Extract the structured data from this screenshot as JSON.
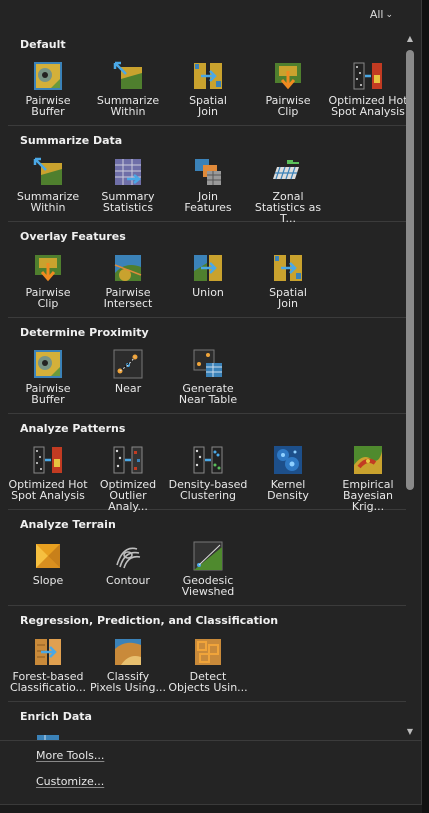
{
  "header": {
    "filter_label": "All"
  },
  "sections": [
    {
      "title": "Default",
      "tools": [
        {
          "label": "Pairwise\nBuffer",
          "icon": "pairwise-buffer-icon"
        },
        {
          "label": "Summarize\nWithin",
          "icon": "summarize-within-icon"
        },
        {
          "label": "Spatial\nJoin",
          "icon": "spatial-join-icon"
        },
        {
          "label": "Pairwise\nClip",
          "icon": "pairwise-clip-icon"
        },
        {
          "label": "Optimized Hot\nSpot Analysis",
          "icon": "hot-spot-icon"
        }
      ]
    },
    {
      "title": "Summarize Data",
      "tools": [
        {
          "label": "Summarize\nWithin",
          "icon": "summarize-within-icon"
        },
        {
          "label": "Summary\nStatistics",
          "icon": "summary-statistics-icon"
        },
        {
          "label": "Join\nFeatures",
          "icon": "join-features-icon"
        },
        {
          "label": "Zonal\nStatistics as T...",
          "icon": "zonal-statistics-icon"
        }
      ]
    },
    {
      "title": "Overlay Features",
      "tools": [
        {
          "label": "Pairwise\nClip",
          "icon": "pairwise-clip-icon"
        },
        {
          "label": "Pairwise\nIntersect",
          "icon": "pairwise-intersect-icon"
        },
        {
          "label": "Union",
          "icon": "union-icon"
        },
        {
          "label": "Spatial\nJoin",
          "icon": "spatial-join-icon"
        }
      ]
    },
    {
      "title": "Determine Proximity",
      "tools": [
        {
          "label": "Pairwise\nBuffer",
          "icon": "pairwise-buffer-icon"
        },
        {
          "label": "Near",
          "icon": "near-icon"
        },
        {
          "label": "Generate\nNear Table",
          "icon": "near-table-icon"
        }
      ]
    },
    {
      "title": "Analyze Patterns",
      "tools": [
        {
          "label": "Optimized Hot\nSpot Analysis",
          "icon": "hot-spot-icon"
        },
        {
          "label": "Optimized\nOutlier Analy...",
          "icon": "outlier-icon"
        },
        {
          "label": "Density-based\nClustering",
          "icon": "clustering-icon"
        },
        {
          "label": "Kernel\nDensity",
          "icon": "kernel-density-icon"
        },
        {
          "label": "Empirical\nBayesian Krig...",
          "icon": "kriging-icon"
        }
      ]
    },
    {
      "title": "Analyze Terrain",
      "tools": [
        {
          "label": "Slope",
          "icon": "slope-icon"
        },
        {
          "label": "Contour",
          "icon": "contour-icon"
        },
        {
          "label": "Geodesic\nViewshed",
          "icon": "viewshed-icon"
        }
      ]
    },
    {
      "title": "Regression, Prediction, and Classification",
      "tools": [
        {
          "label": "Forest-based\nClassificatio...",
          "icon": "forest-classification-icon"
        },
        {
          "label": "Classify\nPixels Using...",
          "icon": "classify-pixels-icon"
        },
        {
          "label": "Detect\nObjects Usin...",
          "icon": "detect-objects-icon"
        }
      ]
    },
    {
      "title": "Enrich Data",
      "tools": []
    }
  ],
  "footer": {
    "more_tools": "More Tools...",
    "customize": "Customize..."
  }
}
